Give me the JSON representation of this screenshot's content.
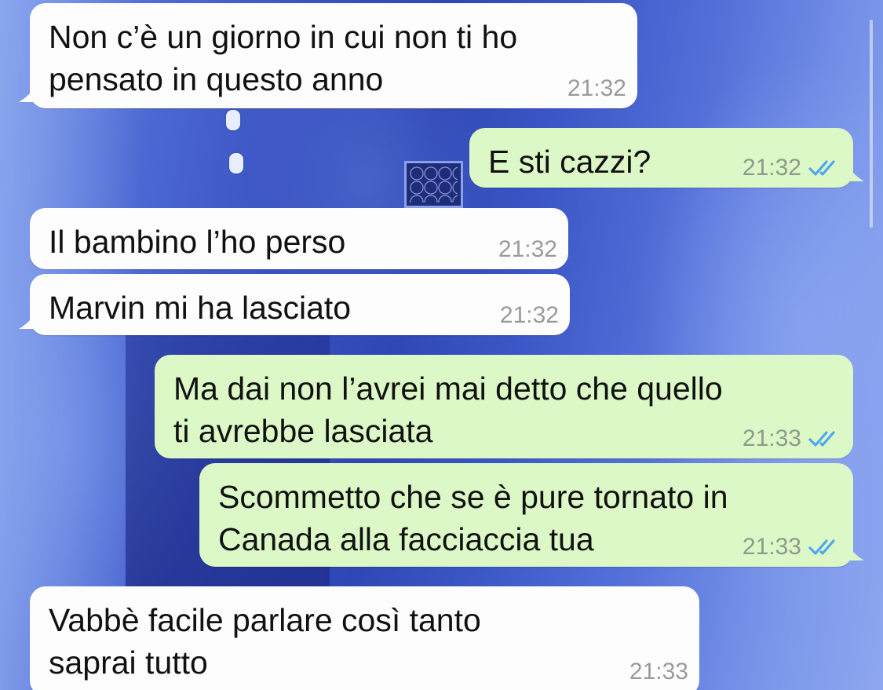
{
  "colors": {
    "incoming_bubble": "#fdfdfd",
    "outgoing_bubble": "#dcf8c6",
    "read_ticks": "#4fa6f0",
    "timestamp": "#8e9a8e",
    "wallpaper": "#3a52c0"
  },
  "messages": [
    {
      "direction": "incoming",
      "text": "Non c’è un giorno in cui non ti ho\npensato in questo anno",
      "time": "21:32"
    },
    {
      "direction": "outgoing",
      "text": "E sti cazzi?",
      "time": "21:32",
      "status_icon": "double-check-read-icon"
    },
    {
      "direction": "incoming",
      "text": "Il bambino l’ho perso",
      "time": "21:32"
    },
    {
      "direction": "incoming",
      "text": "Marvin mi ha lasciato",
      "time": "21:32"
    },
    {
      "direction": "outgoing",
      "text": "Ma dai non l’avrei mai detto che quello\nti avrebbe lasciata",
      "time": "21:33",
      "status_icon": "double-check-read-icon"
    },
    {
      "direction": "outgoing",
      "text": "Scommetto che se è pure tornato in\nCanada alla facciaccia tua",
      "time": "21:33",
      "status_icon": "double-check-read-icon"
    },
    {
      "direction": "incoming",
      "text": "Vabbè facile parlare così tanto\nsaprai tutto",
      "time": "21:33"
    }
  ]
}
